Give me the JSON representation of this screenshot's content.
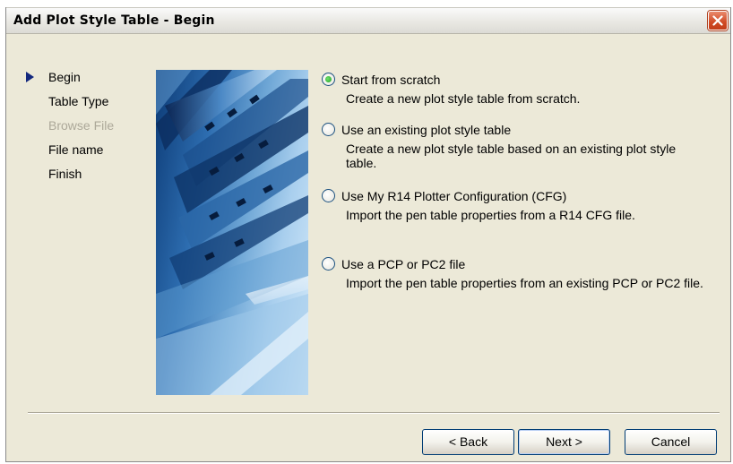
{
  "window": {
    "title": "Add Plot Style Table - Begin"
  },
  "steps": [
    {
      "label": "Begin",
      "current": true,
      "disabled": false
    },
    {
      "label": "Table Type",
      "current": false,
      "disabled": false
    },
    {
      "label": "Browse File",
      "current": false,
      "disabled": true
    },
    {
      "label": "File name",
      "current": false,
      "disabled": false
    },
    {
      "label": "Finish",
      "current": false,
      "disabled": false
    }
  ],
  "options": [
    {
      "label": "Start from scratch",
      "description": "Create a new plot style table from scratch.",
      "selected": true
    },
    {
      "label": "Use an existing plot style table",
      "description": "Create a new plot style table based on an existing plot style table.",
      "selected": false
    },
    {
      "label": "Use My R14 Plotter Configuration (CFG)",
      "description": "Import the pen table properties from a R14 CFG file.",
      "selected": false
    },
    {
      "label": "Use a PCP or PC2 file",
      "description": "Import the pen table properties from an existing PCP or PC2 file.",
      "selected": false
    }
  ],
  "buttons": {
    "back": "< Back",
    "next": "Next >",
    "cancel": "Cancel"
  },
  "colors": {
    "accent": "#13287e",
    "radio_selected": "#21a121",
    "close": "#d04a24",
    "dialog_bg": "#ece9d8",
    "disabled_text": "#aca899"
  },
  "icons": {
    "close": "close-x-icon",
    "current_step": "step-arrow-icon"
  }
}
